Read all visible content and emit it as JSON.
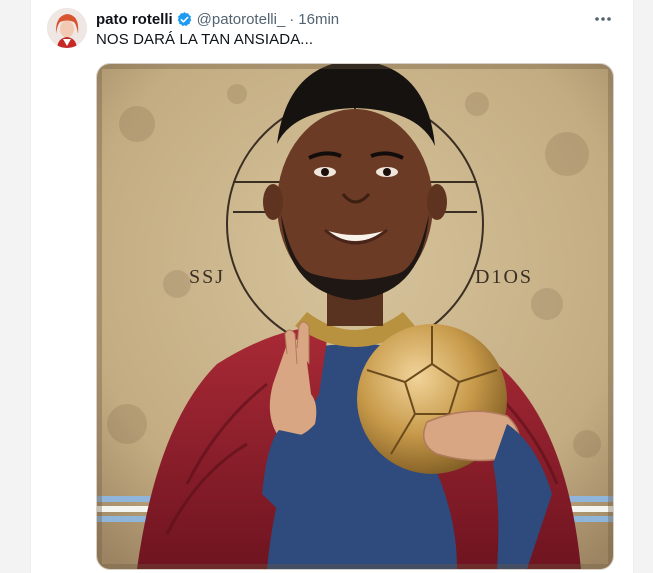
{
  "tweet": {
    "author_name": "pato rotelli",
    "handle": "@patorotelli_",
    "separator": "·",
    "time": "16min",
    "text": "NOS DARÁ LA TAN ANSIADA...",
    "verified": true,
    "more_icon": "more-horizontal-icon"
  },
  "image": {
    "left_inscription": "SSJ",
    "right_inscription": "D1OS",
    "colors": {
      "parchment": "#c9b48c",
      "robe_red": "#8d1f2a",
      "mantle_blue": "#2f4a7c",
      "ball_gold": "#c99a45",
      "accent_blue": "#1d9bf0"
    }
  }
}
